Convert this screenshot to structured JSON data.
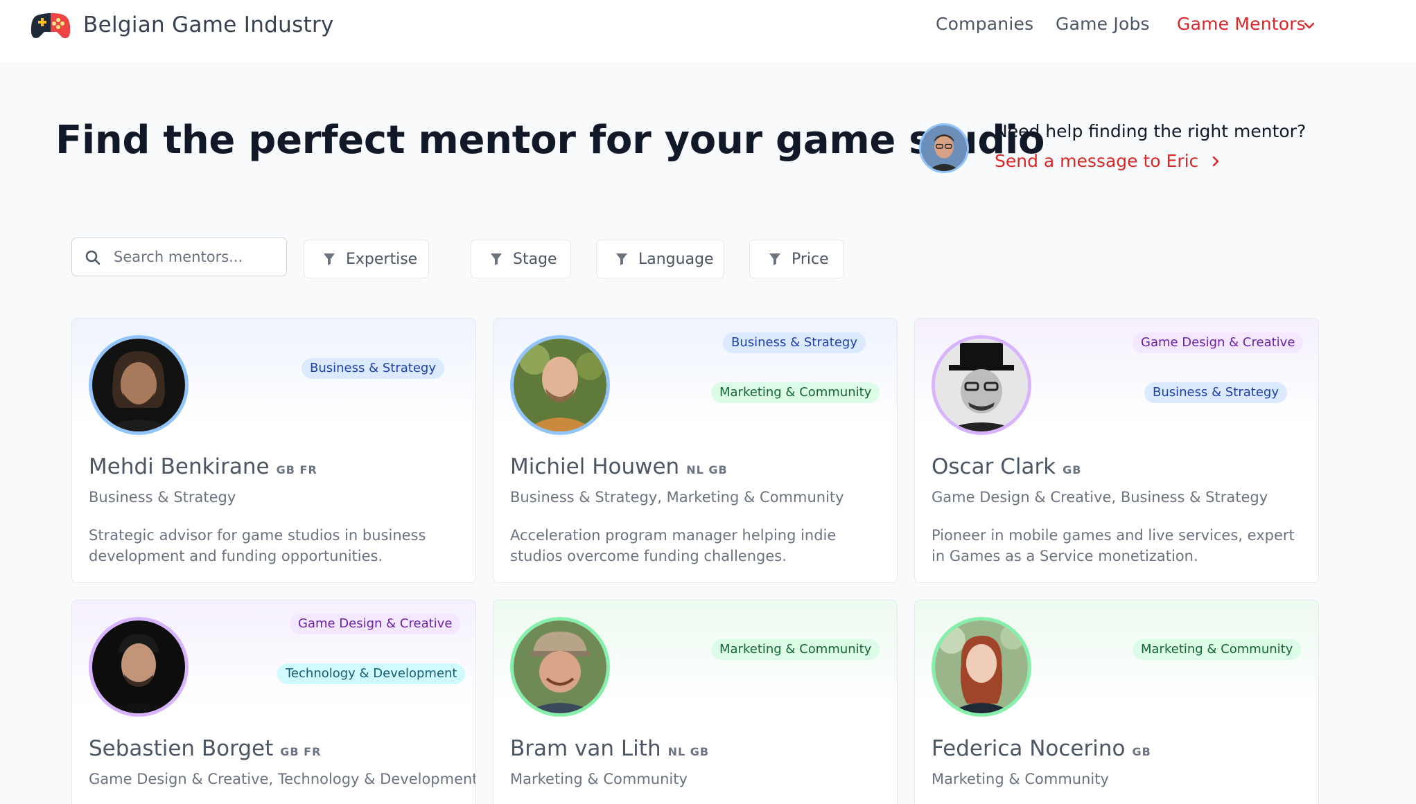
{
  "header": {
    "brand": "Belgian Game Industry",
    "nav": {
      "companies": "Companies",
      "jobs": "Game Jobs",
      "mentors": "Game Mentors"
    }
  },
  "hero": {
    "title": "Find the perfect mentor for your game studio",
    "help_title": "Need help finding the right mentor?",
    "help_link": "Send a message to Eric"
  },
  "filters": {
    "search_placeholder": "Search mentors...",
    "expertise": "Expertise",
    "stage": "Stage",
    "language": "Language",
    "price": "Price"
  },
  "mentors": [
    {
      "name": "Mehdi Benkirane",
      "langs": "GB FR",
      "categories": "Business & Strategy",
      "bio": "Strategic advisor for game studios in business development and funding opportunities.",
      "tags": [
        "Business & Strategy"
      ]
    },
    {
      "name": "Michiel Houwen",
      "langs": "NL GB",
      "categories": "Business & Strategy, Marketing & Community",
      "bio": "Acceleration program manager helping indie studios overcome funding challenges.",
      "tags": [
        "Business & Strategy",
        "Marketing & Community"
      ]
    },
    {
      "name": "Oscar Clark",
      "langs": "GB",
      "categories": "Game Design & Creative, Business & Strategy",
      "bio": "Pioneer in mobile games and live services, expert in Games as a Service monetization.",
      "tags": [
        "Game Design & Creative",
        "Business & Strategy"
      ]
    },
    {
      "name": "Sebastien Borget",
      "langs": "GB FR",
      "categories": "Game Design & Creative, Technology & Development",
      "tags": [
        "Game Design & Creative",
        "Technology & Development"
      ]
    },
    {
      "name": "Bram van Lith",
      "langs": "NL GB",
      "categories": "Marketing & Community",
      "tags": [
        "Marketing & Community"
      ]
    },
    {
      "name": "Federica Nocerino",
      "langs": "GB",
      "categories": "Marketing & Community",
      "tags": [
        "Marketing & Community"
      ]
    }
  ],
  "colors": {
    "accent": "#dc2626",
    "blue_tag": "#dbeafe",
    "purple_tag": "#f3e8ff",
    "green_tag": "#dcfce7",
    "teal_tag": "#cffafe"
  }
}
